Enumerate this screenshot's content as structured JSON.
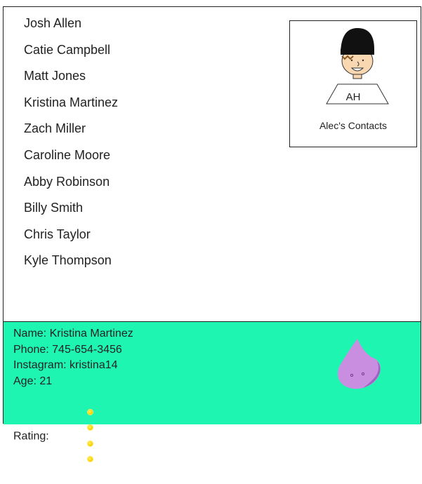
{
  "contacts": [
    "Josh Allen",
    "Catie Campbell",
    "Matt Jones",
    "Kristina Martinez",
    "Zach Miller",
    "Caroline Moore",
    "Abby Robinson",
    "Billy Smith",
    "Chris Taylor",
    "Kyle Thompson"
  ],
  "profile": {
    "initials": "AH",
    "title": "Alec's Contacts"
  },
  "details": {
    "name_line": "Name: Kristina Martinez",
    "phone_line": "Phone: 745-654-3456",
    "instagram_line": "Instagram: kristina14",
    "age_line": "Age: 21",
    "rating_label": "Rating:",
    "rating_value": 4,
    "rating_max": 4,
    "background_color": "#1ef5b0",
    "mascot_icon": "purple-drop-creature-icon"
  },
  "colors": {
    "panel": "#1ef5b0",
    "mascot": "#c98ee0",
    "star": "#ffd400"
  }
}
